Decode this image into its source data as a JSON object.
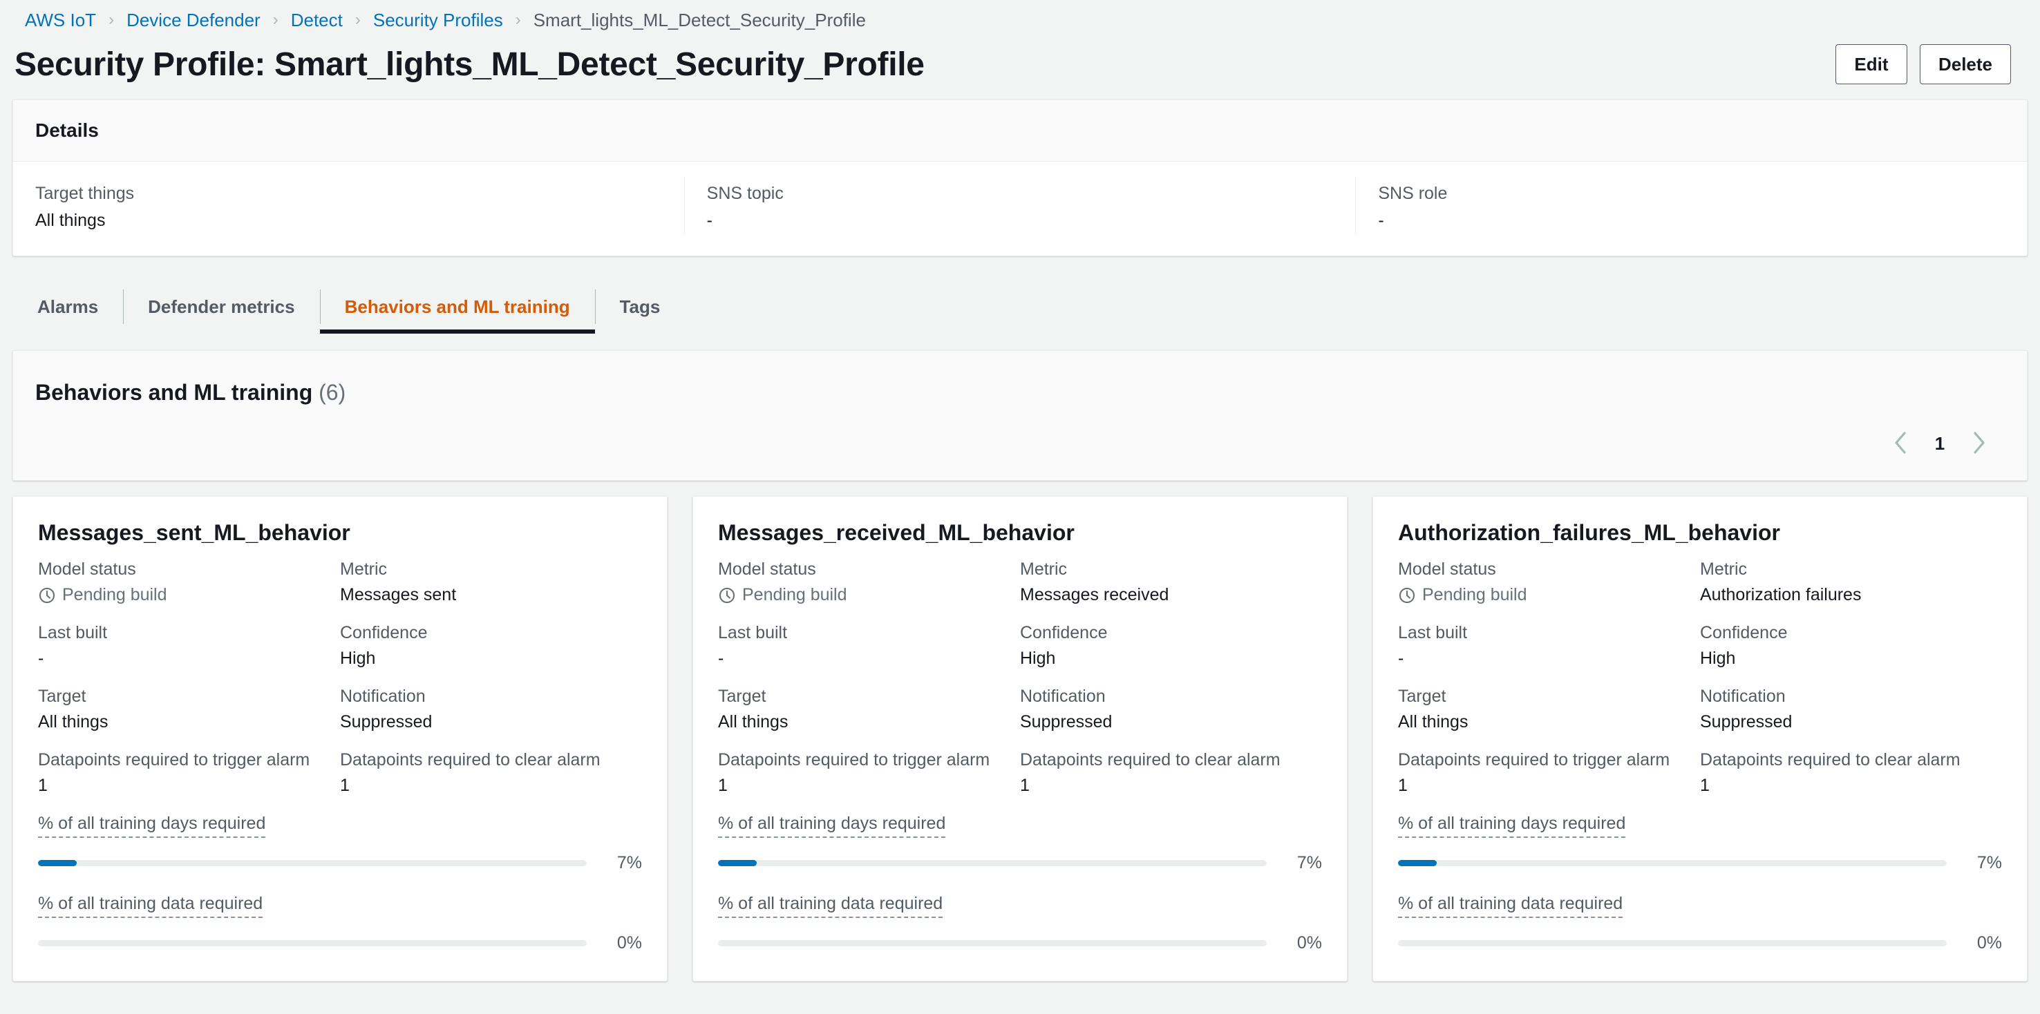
{
  "breadcrumb": {
    "items": [
      {
        "label": "AWS IoT",
        "current": false
      },
      {
        "label": "Device Defender",
        "current": false
      },
      {
        "label": "Detect",
        "current": false
      },
      {
        "label": "Security Profiles",
        "current": false
      },
      {
        "label": "Smart_lights_ML_Detect_Security_Profile",
        "current": true
      }
    ],
    "separator": "›"
  },
  "header": {
    "title": "Security Profile: Smart_lights_ML_Detect_Security_Profile",
    "edit_label": "Edit",
    "delete_label": "Delete"
  },
  "details": {
    "title": "Details",
    "columns": [
      {
        "label": "Target things",
        "value": "All things"
      },
      {
        "label": "SNS topic",
        "value": "-"
      },
      {
        "label": "SNS role",
        "value": "-"
      }
    ]
  },
  "tabs": [
    {
      "label": "Alarms",
      "active": false
    },
    {
      "label": "Defender metrics",
      "active": false
    },
    {
      "label": "Behaviors and ML training",
      "active": true
    },
    {
      "label": "Tags",
      "active": false
    }
  ],
  "behaviors_section": {
    "title": "Behaviors and ML training",
    "count": "(6)",
    "pagination": {
      "prev_icon": "chevron-left-icon",
      "next_icon": "chevron-right-icon",
      "current_page": "1"
    }
  },
  "cards": [
    {
      "title": "Messages_sent_ML_behavior",
      "model_status_label": "Model status",
      "model_status_value": "Pending build",
      "model_status_icon": "clock-icon",
      "metric_label": "Metric",
      "metric_value": "Messages sent",
      "last_built_label": "Last built",
      "last_built_value": "-",
      "confidence_label": "Confidence",
      "confidence_value": "High",
      "target_label": "Target",
      "target_value": "All things",
      "notification_label": "Notification",
      "notification_value": "Suppressed",
      "trigger_label": "Datapoints required to trigger alarm",
      "trigger_value": "1",
      "clear_label": "Datapoints required to clear alarm",
      "clear_value": "1",
      "training_days_label": "% of all training days required",
      "training_days_pct": "7%",
      "training_days_value": 7,
      "training_data_label": "% of all training data required",
      "training_data_pct": "0%",
      "training_data_value": 0
    },
    {
      "title": "Messages_received_ML_behavior",
      "model_status_label": "Model status",
      "model_status_value": "Pending build",
      "model_status_icon": "clock-icon",
      "metric_label": "Metric",
      "metric_value": "Messages received",
      "last_built_label": "Last built",
      "last_built_value": "-",
      "confidence_label": "Confidence",
      "confidence_value": "High",
      "target_label": "Target",
      "target_value": "All things",
      "notification_label": "Notification",
      "notification_value": "Suppressed",
      "trigger_label": "Datapoints required to trigger alarm",
      "trigger_value": "1",
      "clear_label": "Datapoints required to clear alarm",
      "clear_value": "1",
      "training_days_label": "% of all training days required",
      "training_days_pct": "7%",
      "training_days_value": 7,
      "training_data_label": "% of all training data required",
      "training_data_pct": "0%",
      "training_data_value": 0
    },
    {
      "title": "Authorization_failures_ML_behavior",
      "model_status_label": "Model status",
      "model_status_value": "Pending build",
      "model_status_icon": "clock-icon",
      "metric_label": "Metric",
      "metric_value": "Authorization failures",
      "last_built_label": "Last built",
      "last_built_value": "-",
      "confidence_label": "Confidence",
      "confidence_value": "High",
      "target_label": "Target",
      "target_value": "All things",
      "notification_label": "Notification",
      "notification_value": "Suppressed",
      "trigger_label": "Datapoints required to trigger alarm",
      "trigger_value": "1",
      "clear_label": "Datapoints required to clear alarm",
      "clear_value": "1",
      "training_days_label": "% of all training days required",
      "training_days_pct": "7%",
      "training_days_value": 7,
      "training_data_label": "% of all training data required",
      "training_data_pct": "0%",
      "training_data_value": 0
    }
  ],
  "colors": {
    "link": "#0073bb",
    "active_tab": "#d45b07",
    "progress_fill": "#0073bb",
    "page_bg": "#f2f3f3",
    "muted_text": "#545b64"
  }
}
